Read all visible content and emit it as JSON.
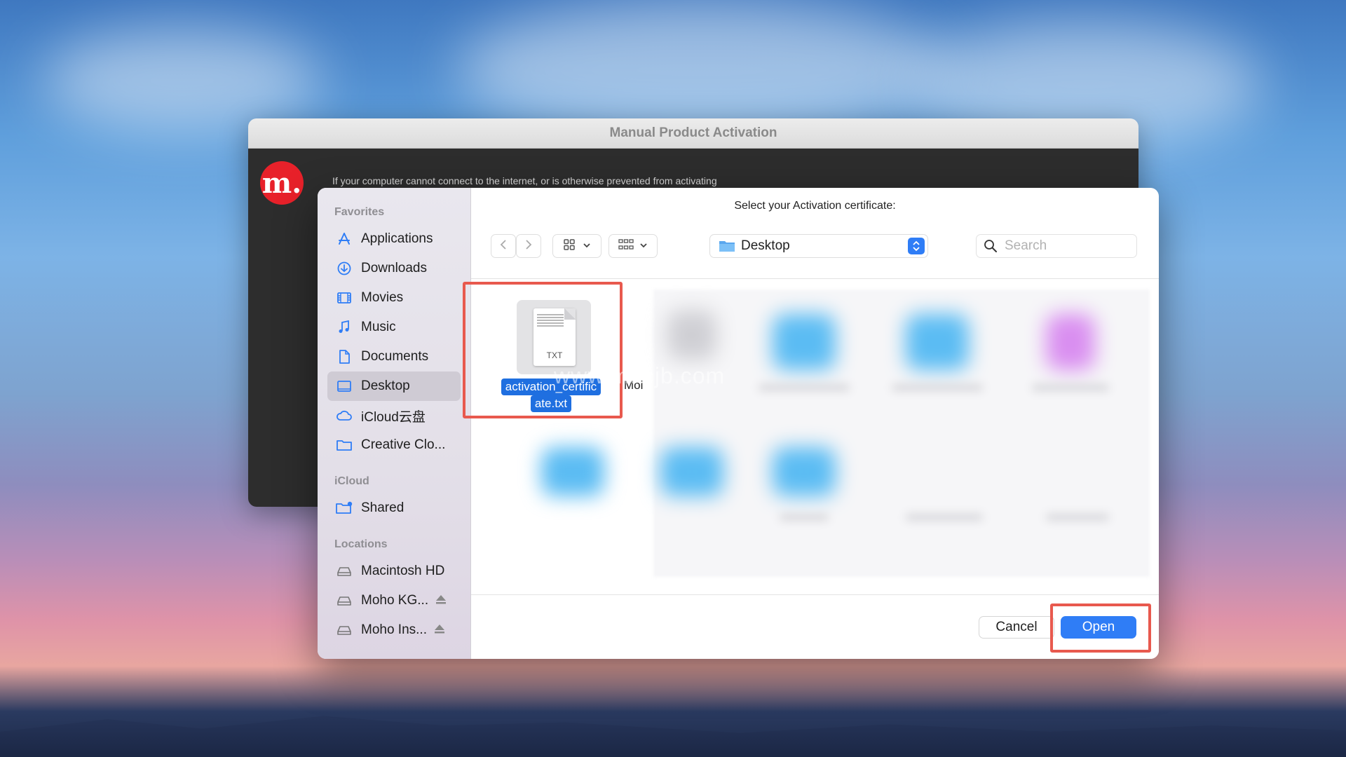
{
  "background_window": {
    "title": "Manual Product Activation",
    "logo_text": "m.",
    "body_text": "If your computer cannot connect to the internet, or is otherwise prevented from activating"
  },
  "dialog": {
    "prompt": "Select your Activation certificate:",
    "sidebar": {
      "favorites_label": "Favorites",
      "favorites": [
        {
          "label": "Applications",
          "icon": "applications-icon"
        },
        {
          "label": "Downloads",
          "icon": "downloads-icon"
        },
        {
          "label": "Movies",
          "icon": "movies-icon"
        },
        {
          "label": "Music",
          "icon": "music-icon"
        },
        {
          "label": "Documents",
          "icon": "documents-icon"
        },
        {
          "label": "Desktop",
          "icon": "desktop-icon",
          "selected": true
        },
        {
          "label": "iCloud云盘",
          "icon": "icloud-icon"
        },
        {
          "label": "Creative Clo...",
          "icon": "folder-icon"
        }
      ],
      "icloud_label": "iCloud",
      "icloud": [
        {
          "label": "Shared",
          "icon": "shared-folder-icon"
        }
      ],
      "locations_label": "Locations",
      "locations": [
        {
          "label": "Macintosh HD",
          "icon": "drive-icon"
        },
        {
          "label": "Moho KG...",
          "icon": "drive-icon",
          "eject": true
        },
        {
          "label": "Moho Ins...",
          "icon": "drive-icon",
          "eject": true
        }
      ]
    },
    "toolbar": {
      "location": "Desktop",
      "search_placeholder": "Search"
    },
    "files": {
      "selected_file": {
        "name_line1": "activation_certific",
        "name_line2": "ate.txt",
        "type_label": "TXT"
      },
      "partial_name": "Moi"
    },
    "watermark": "www.macjb.com",
    "buttons": {
      "cancel": "Cancel",
      "open": "Open"
    },
    "colors": {
      "accent": "#2f7df6",
      "selection": "#1f6fe0",
      "highlight": "#e8594e",
      "logo": "#e8212a"
    }
  }
}
